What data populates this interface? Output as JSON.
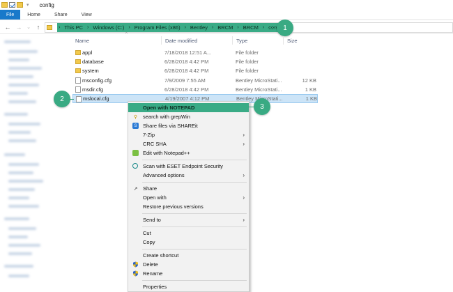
{
  "window": {
    "title": "config"
  },
  "ribbon": {
    "tabs": [
      "File",
      "Home",
      "Share",
      "View"
    ]
  },
  "nav": {
    "back": "←",
    "forward": "→",
    "down": "⌄",
    "up": "↑"
  },
  "breadcrumbs": [
    "This PC",
    "Windows (C:)",
    "Program Files (x86)",
    "Bentley",
    "BRCM",
    "BRCM",
    "config"
  ],
  "crumb_separator": "›",
  "callouts": [
    "1",
    "2",
    "3"
  ],
  "columns": {
    "name": "Name",
    "date": "Date modified",
    "type": "Type",
    "size": "Size"
  },
  "files": [
    {
      "name": "appl",
      "date": "7/18/2018 12:51 A...",
      "type": "File folder",
      "size": "",
      "icon": "folder"
    },
    {
      "name": "database",
      "date": "6/28/2018 4:42 PM",
      "type": "File folder",
      "size": "",
      "icon": "folder"
    },
    {
      "name": "system",
      "date": "6/28/2018 4:42 PM",
      "type": "File folder",
      "size": "",
      "icon": "folder"
    },
    {
      "name": "msconfig.cfg",
      "date": "7/9/2009 7:55 AM",
      "type": "Bentley MicroStati...",
      "size": "12 KB",
      "icon": "doc"
    },
    {
      "name": "msdir.cfg",
      "date": "6/28/2018 4:42 PM",
      "type": "Bentley MicroStati...",
      "size": "1 KB",
      "icon": "doc"
    },
    {
      "name": "mslocal.cfg",
      "date": "4/19/2007 4:12 PM",
      "type": "Bentley MicroStati...",
      "size": "1 KB",
      "icon": "doc",
      "selected": true
    }
  ],
  "context_menu": {
    "items": [
      {
        "label": "Open with NOTEPAD",
        "highlighted": true
      },
      {
        "label": "search with grepWin",
        "icon": "search-icon"
      },
      {
        "label": "Share files via SHAREit",
        "icon": "shareit-icon"
      },
      {
        "label": "7-Zip",
        "submenu": true
      },
      {
        "label": "CRC SHA",
        "submenu": true
      },
      {
        "label": "Edit with Notepad++",
        "icon": "notepadpp-icon"
      },
      {
        "label": "Scan with ESET Endpoint Security",
        "icon": "eset-icon"
      },
      {
        "label": "Advanced options",
        "submenu": true
      },
      {
        "label": "Share",
        "icon": "share-icon"
      },
      {
        "label": "Open with",
        "submenu": true
      },
      {
        "label": "Restore previous versions"
      },
      {
        "label": "Send to",
        "submenu": true
      },
      {
        "label": "Cut"
      },
      {
        "label": "Copy"
      },
      {
        "label": "Create shortcut"
      },
      {
        "label": "Delete",
        "icon": "shield-icon"
      },
      {
        "label": "Rename",
        "icon": "shield-icon"
      },
      {
        "label": "Properties"
      }
    ],
    "submenu_arrow": "›"
  },
  "colors": {
    "accent": "#3aab86",
    "file_tab": "#1979ca",
    "selection": "#cce4f7"
  }
}
